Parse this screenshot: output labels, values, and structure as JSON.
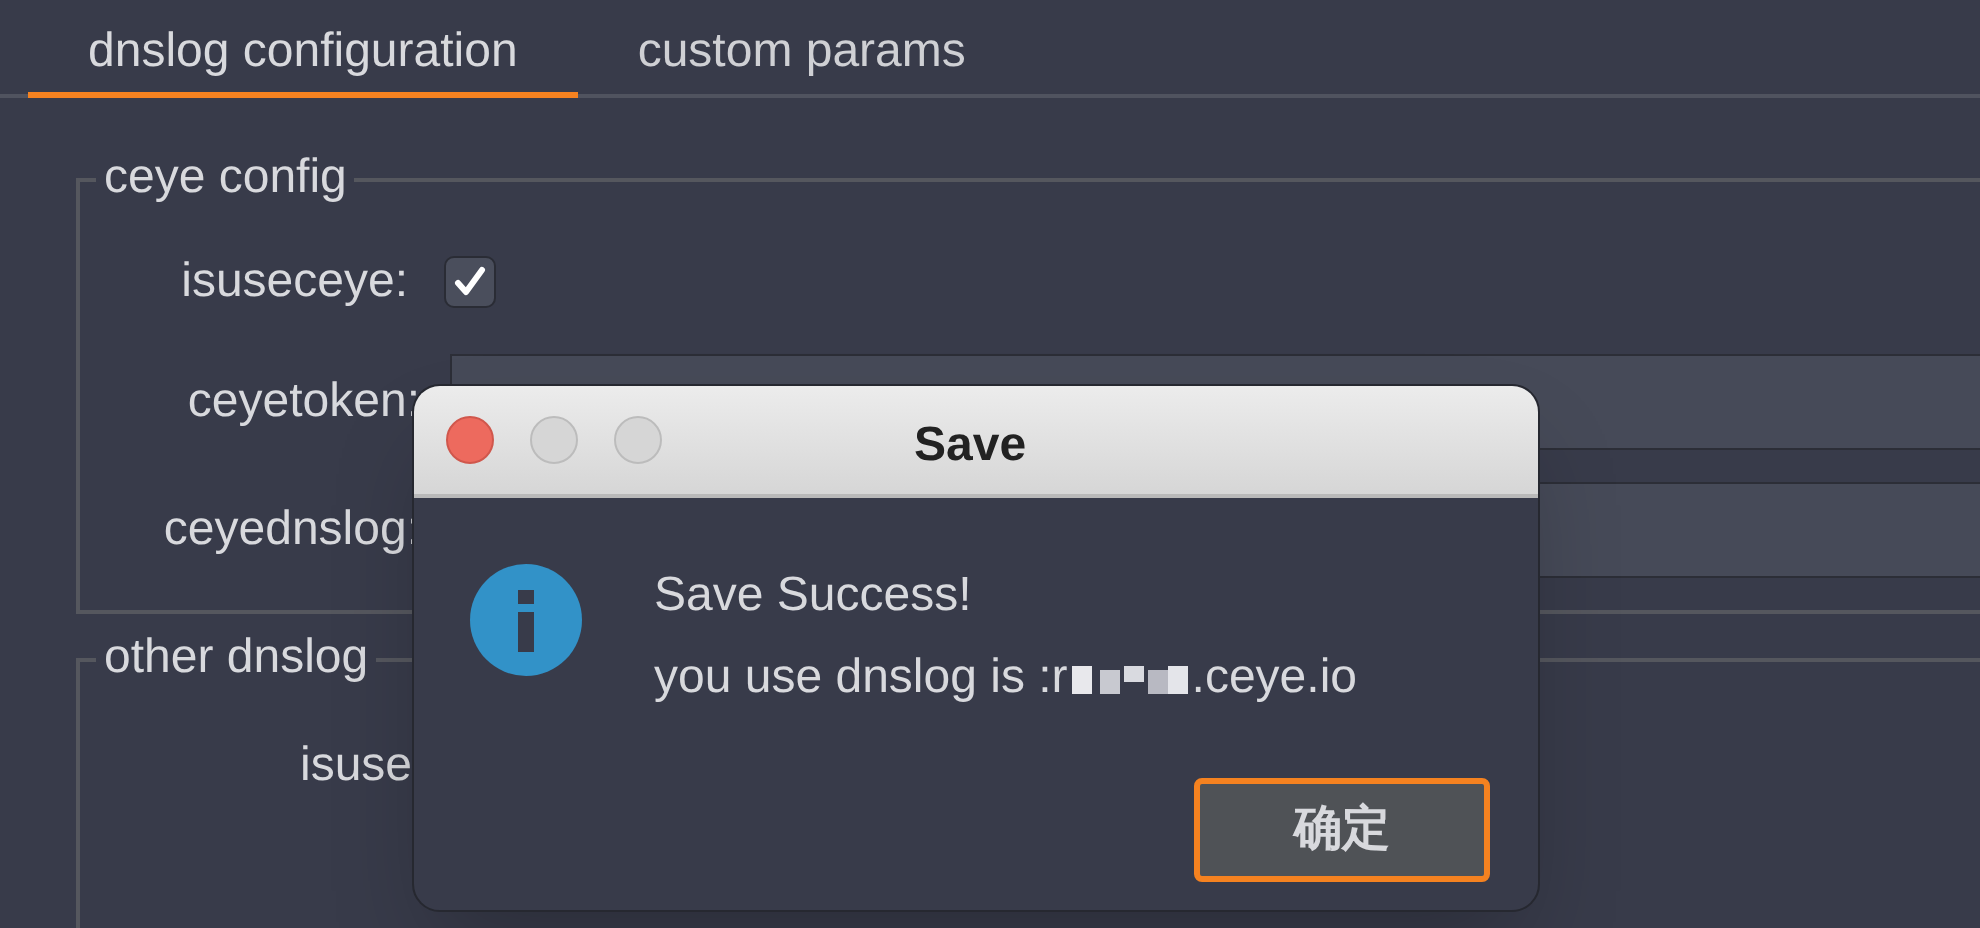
{
  "tabs": [
    {
      "label": "dnslog configuration",
      "selected": true
    },
    {
      "label": "custom params",
      "selected": false
    }
  ],
  "ceye_config": {
    "title": "ceye config",
    "isuseceye": {
      "label": "isuseceye:",
      "checked": true
    },
    "ceyetoken": {
      "label": "ceyetoken:"
    },
    "ceyednslog": {
      "label": "ceyednslog:"
    }
  },
  "other_dnslog": {
    "title": "other dnslog",
    "isuse": {
      "label": "isuse"
    }
  },
  "dialog": {
    "title": "Save",
    "message": "Save Success!",
    "detail_prefix": "you use dnslog is :r",
    "detail_suffix": ".ceye.io",
    "button": "确定"
  }
}
